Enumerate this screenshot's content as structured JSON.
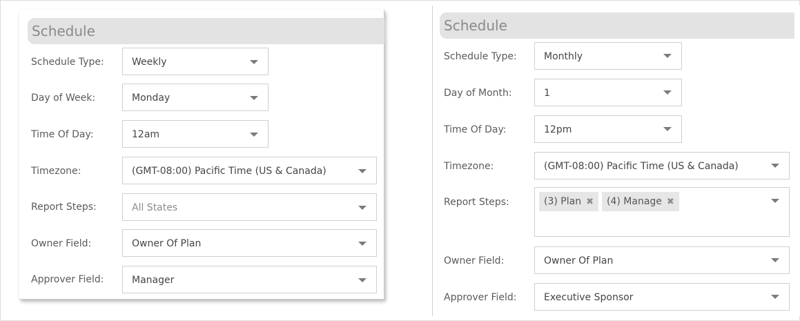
{
  "left": {
    "header": "Schedule",
    "schedule_type": {
      "label": "Schedule Type:",
      "value": "Weekly"
    },
    "day": {
      "label": "Day of Week:",
      "value": "Monday"
    },
    "time": {
      "label": "Time Of Day:",
      "value": "12am"
    },
    "timezone": {
      "label": "Timezone:",
      "value": "(GMT-08:00) Pacific Time (US & Canada)"
    },
    "report_steps": {
      "label": "Report Steps:",
      "placeholder": "All States"
    },
    "owner": {
      "label": "Owner Field:",
      "value": "Owner Of Plan"
    },
    "approver": {
      "label": "Approver Field:",
      "value": "Manager"
    }
  },
  "right": {
    "header": "Schedule",
    "schedule_type": {
      "label": "Schedule Type:",
      "value": "Monthly"
    },
    "day": {
      "label": "Day of Month:",
      "value": "1"
    },
    "time": {
      "label": "Time Of Day:",
      "value": "12pm"
    },
    "timezone": {
      "label": "Timezone:",
      "value": "(GMT-08:00) Pacific Time (US & Canada)"
    },
    "report_steps": {
      "label": "Report Steps:",
      "tags": [
        {
          "label": "(3) Plan",
          "remove_icon": "✖"
        },
        {
          "label": "(4) Manage",
          "remove_icon": "✖"
        }
      ]
    },
    "owner": {
      "label": "Owner Field:",
      "value": "Owner Of Plan"
    },
    "approver": {
      "label": "Approver Field:",
      "value": "Executive Sponsor"
    }
  }
}
